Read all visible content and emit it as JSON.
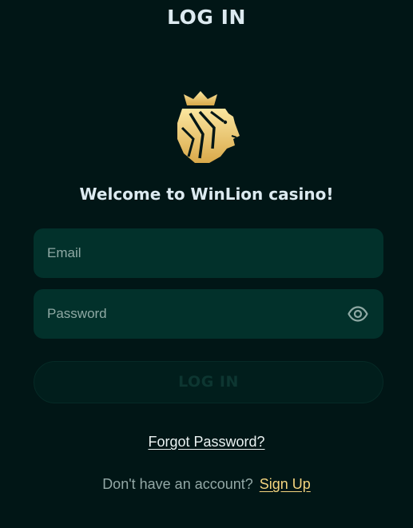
{
  "header": {
    "title": "LOG IN"
  },
  "logo": {
    "icon": "lion-crown-logo",
    "color_light": "#fbe6a0",
    "color_dark": "#d9a94a"
  },
  "welcome": {
    "text": "Welcome to WinLion casino!"
  },
  "form": {
    "email": {
      "placeholder": "Email",
      "value": ""
    },
    "password": {
      "placeholder": "Password",
      "value": "",
      "toggle_icon": "eye-icon"
    },
    "login_button_label": "LOG IN"
  },
  "links": {
    "forgot_password": "Forgot Password?",
    "signup_prompt": "Don't have an account?",
    "signup_label": "Sign Up"
  },
  "colors": {
    "background": "#011616",
    "field_background": "#02312b",
    "accent_gold": "#f4d47e",
    "text_primary": "#dceaf0"
  }
}
